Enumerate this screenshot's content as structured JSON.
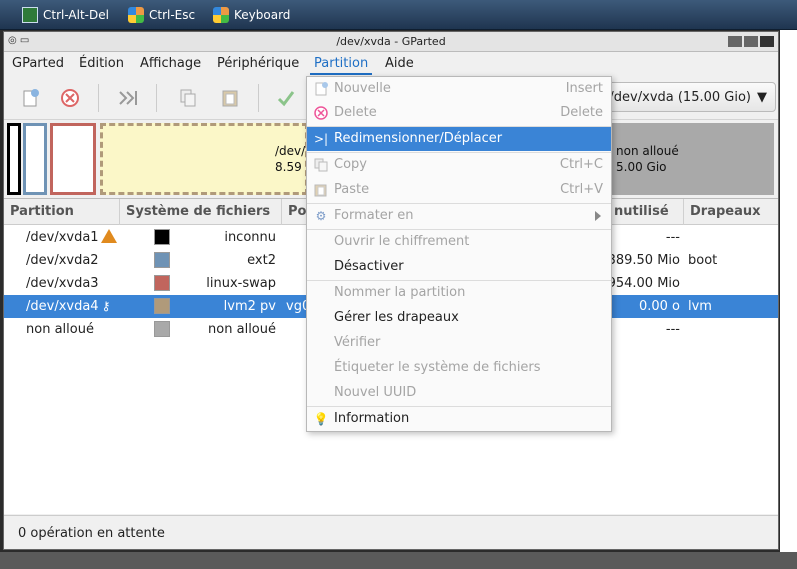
{
  "viewer": {
    "ctrl_alt_del": "Ctrl-Alt-Del",
    "ctrl_esc": "Ctrl-Esc",
    "keyboard": "Keyboard"
  },
  "window": {
    "title": "/dev/xvda - GParted"
  },
  "menubar": [
    "GParted",
    "Édition",
    "Affichage",
    "Périphérique",
    "Partition",
    "Aide"
  ],
  "toolbar": {
    "device_select": "/dev/xvda (15.00 Gio)"
  },
  "graphic": {
    "xvda4_name": "/dev/",
    "xvda4_size": "8.59",
    "unalloc_name": "non alloué",
    "unalloc_size": "5.00 Gio"
  },
  "table": {
    "headers": [
      "Partition",
      "Système de fichiers",
      "Po",
      "nutilisé",
      "Drapeaux"
    ],
    "rows": [
      {
        "partition": "/dev/xvda1",
        "color": "#000000",
        "fs": "inconnu",
        "unused": "---",
        "flags": "",
        "icon": "warning-icon"
      },
      {
        "partition": "/dev/xvda2",
        "color": "#6f93b5",
        "fs": "ext2",
        "unused": "389.50 Mio",
        "flags": "boot"
      },
      {
        "partition": "/dev/xvda3",
        "color": "#c1655d",
        "fs": "linux-swap",
        "unused": "954.00 Mio",
        "flags": ""
      },
      {
        "partition": "/dev/xvda4",
        "color": "#b09a7a",
        "fs": "lvm2 pv",
        "mount": "vg0",
        "unused": "0.00 o",
        "flags": "lvm",
        "icon": "key-icon"
      },
      {
        "partition": "non alloué",
        "color": "#a9a9a9",
        "fs": "non alloué",
        "unused": "---",
        "flags": ""
      }
    ]
  },
  "status": "0 opération en attente",
  "dropdown": {
    "items": [
      {
        "label": "Nouvelle",
        "accel": "Insert",
        "icon": "new-icon",
        "enabled": false
      },
      {
        "label": "Delete",
        "accel": "Delete",
        "icon": "delete-icon",
        "enabled": false
      },
      {
        "label": "Redimensionner/Déplacer",
        "accel": "",
        "icon": "resize-icon",
        "enabled": true,
        "highlighted": true
      },
      {
        "label": "Copy",
        "accel": "Ctrl+C",
        "icon": "copy-icon",
        "enabled": false
      },
      {
        "label": "Paste",
        "accel": "Ctrl+V",
        "icon": "paste-icon",
        "enabled": false
      },
      {
        "label": "Formater en",
        "accel": "",
        "icon": "format-icon",
        "enabled": false,
        "submenu": true
      },
      {
        "label": "Ouvrir le chiffrement",
        "accel": "",
        "enabled": false
      },
      {
        "label": "Désactiver",
        "accel": "",
        "enabled": true
      },
      {
        "label": "Nommer la partition",
        "accel": "",
        "enabled": false
      },
      {
        "label": "Gérer les drapeaux",
        "accel": "",
        "enabled": true
      },
      {
        "label": "Vérifier",
        "accel": "",
        "enabled": false
      },
      {
        "label": "Étiqueter le système de fichiers",
        "accel": "",
        "enabled": false
      },
      {
        "label": "Nouvel UUID",
        "accel": "",
        "enabled": false
      },
      {
        "label": "Information",
        "accel": "",
        "icon": "info-icon",
        "enabled": true
      }
    ]
  }
}
